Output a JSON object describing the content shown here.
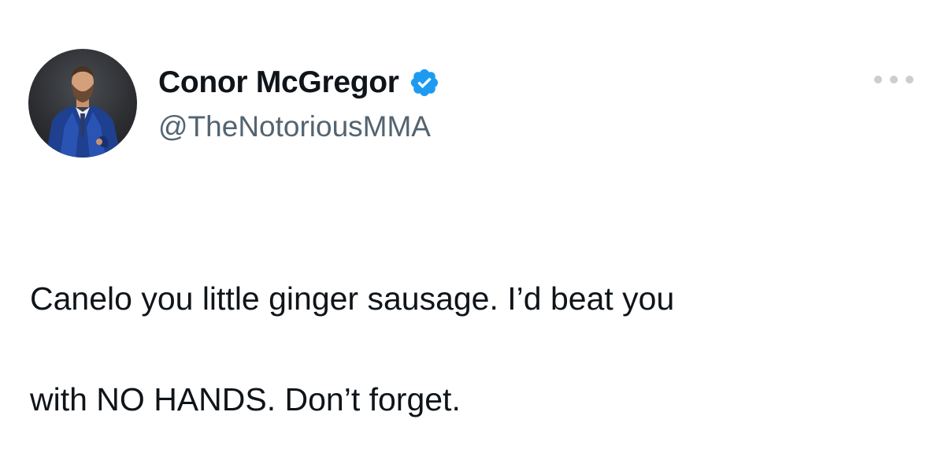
{
  "tweet": {
    "author": {
      "display_name": "Conor McGregor",
      "handle": "@TheNotoriousMMA",
      "verified": true,
      "verified_color": "#1d9bf0",
      "avatar_icon": "profile-photo"
    },
    "more_icon": "more-horizontal-icon",
    "lines": [
      "Canelo you little ginger sausage. I’d beat you",
      "with NO HANDS. Don’t forget."
    ]
  },
  "colors": {
    "text": "#0f1419",
    "secondary_text": "#536471",
    "background": "#ffffff"
  }
}
